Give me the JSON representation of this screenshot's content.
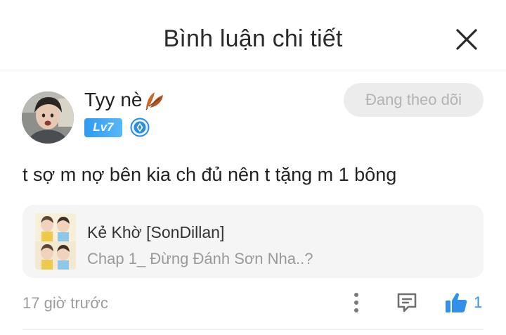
{
  "header": {
    "title": "Bình luận chi tiết",
    "close_icon": "close-icon"
  },
  "comment": {
    "author": {
      "name": "Tyy nè",
      "name_icon": "autumn-leaf-icon",
      "avatar": "user-avatar-photo",
      "level": "Lv7",
      "rank_icon": "diamond-rank-icon"
    },
    "follow_label": "Đang theo dõi",
    "text": "t sợ m nợ bên kia ch đủ nên t tặng m 1 bông",
    "story": {
      "cover": "story-cover-thumbnail",
      "title": "Kẻ Khờ [SonDillan]",
      "chapter": "Chap 1_ Đừng Đánh Sơn Nha..?"
    },
    "time": "17 giờ trước",
    "actions": {
      "more_icon": "more-vertical-icon",
      "reply_icon": "comment-icon",
      "like_icon": "thumbs-up-icon",
      "like_count": "1"
    }
  },
  "colors": {
    "accent": "#3390e8",
    "level_badge": "#2f9af0",
    "follow_bg": "#ececec",
    "follow_text": "#b3b3b3",
    "muted_text": "#9c9c9c"
  }
}
